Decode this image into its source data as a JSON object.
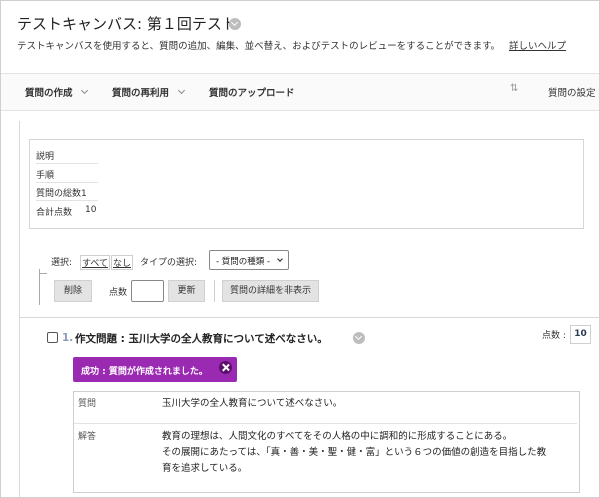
{
  "header": {
    "title": "テストキャンバス: 第１回テスト",
    "subtitle": "テストキャンバスを使用すると、質問の追加、編集、並べ替え、およびテストのレビューをすることができます。",
    "help_link": "詳しいヘルプ"
  },
  "toolbar": {
    "create": "質問の作成",
    "reuse": "質問の再利用",
    "upload": "質問のアップロード",
    "settings": "質問の設定",
    "sort_icon": "sort-arrows-icon"
  },
  "info": {
    "description": "説明",
    "instructions": "手順",
    "total_questions": "質問の総数1",
    "total_points_label": "合計点数",
    "total_points_value": "10"
  },
  "selection": {
    "select_label": "選択:",
    "all": "すべて",
    "none": "なし",
    "type_label": "タイプの選択:",
    "type_select_value": "- 質問の種類 -"
  },
  "actions": {
    "delete": "削除",
    "points_label": "点数",
    "points_value": "",
    "update": "更新",
    "hide_details": "質問の詳細を非表示"
  },
  "question": {
    "number": "1.",
    "title": "作文問題 : 玉川大学の全人教育について述べなさい。",
    "points_label": "点数 :",
    "points_value": "10",
    "banner": "成功 : 質問が作成されました。",
    "question_label": "質問",
    "question_text": "玉川大学の全人教育について述べなさい。",
    "answer_label": "解答",
    "answer_lines": [
      "教育の理想は、人間文化のすべてをその人格の中に調和的に形成することにある。",
      "その展開にあたっては、「真・善・美・聖・健・富」という６つの価値の創造を目指した教",
      "育を追求している。"
    ]
  },
  "colors": {
    "banner_bg": "#9b2ab3",
    "number_color": "#8a9ab8"
  }
}
